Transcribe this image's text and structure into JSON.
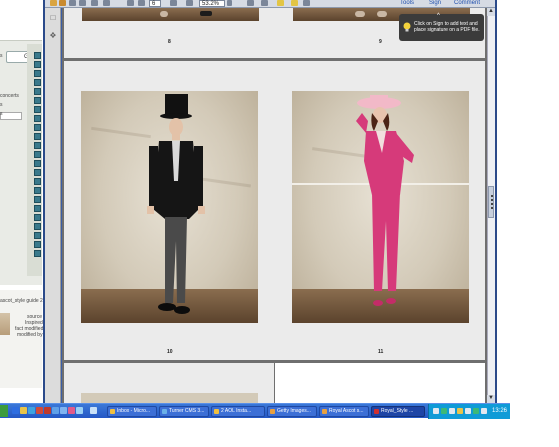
{
  "background_page": {
    "go_button": "Go",
    "side_texts": [
      "s",
      "concerts",
      "s",
      "s"
    ],
    "guide_link": "ascot_style guide 2",
    "guide_caption": [
      "source",
      "Inspired",
      "fact modified",
      "modified by"
    ]
  },
  "viewer": {
    "toolbar": {
      "page_field": "6",
      "zoom_field": "53.2%",
      "tools_link": "Tools",
      "sign_link": "Sign",
      "comment_link": "Comment"
    },
    "tooltip": {
      "text": "Click on Sign to add text and place signature on a PDF file."
    },
    "pages": {
      "top_left_number": "8",
      "top_right_number": "9",
      "left_number": "10",
      "right_number": "11"
    }
  },
  "taskbar": {
    "tasks": [
      {
        "label": "Inbox - Micro..."
      },
      {
        "label": "Turner CMS 3..."
      },
      {
        "label": "2 AOL Insta..."
      },
      {
        "label": "Getty Images..."
      },
      {
        "label": "Royal Ascot s..."
      },
      {
        "label": "Royal_Style ..."
      }
    ],
    "clock": "13:26"
  },
  "colors": {
    "viewer_frame": "#3a5ea8",
    "page_bg": "#ebebeb",
    "pink_suit": "#d63a7a",
    "taskbar": "#2457c5"
  }
}
